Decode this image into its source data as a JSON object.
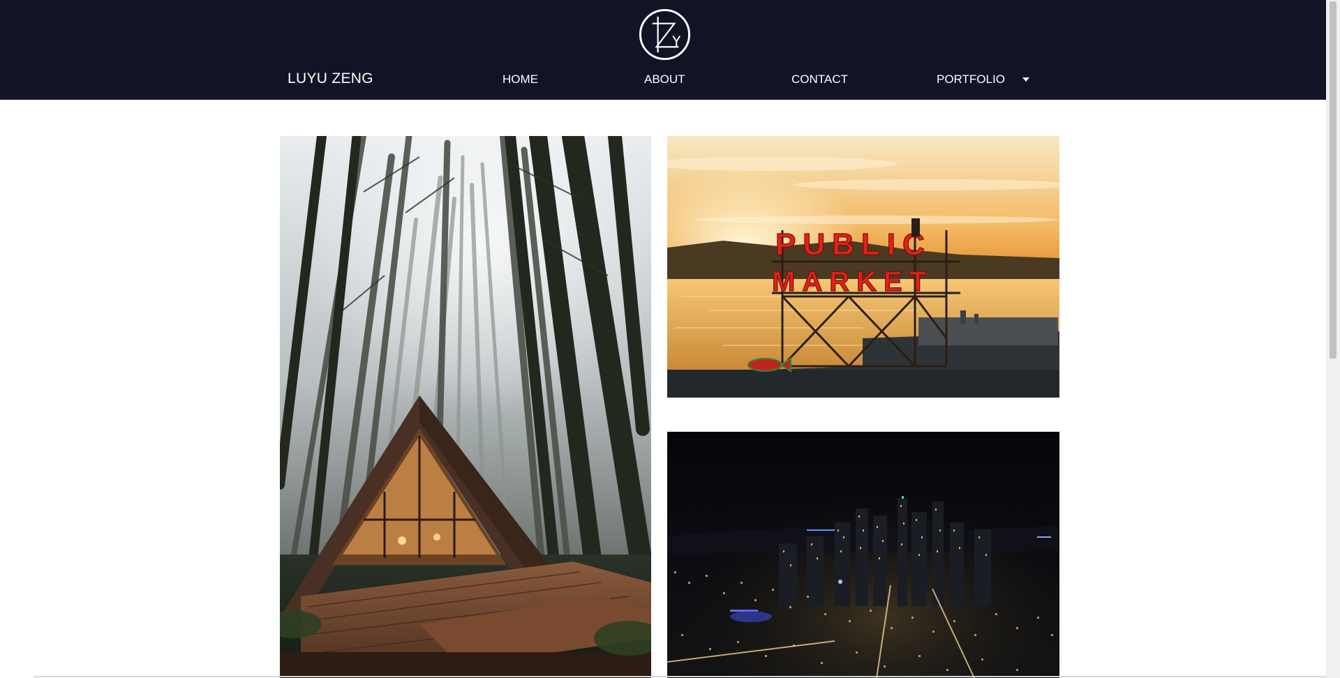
{
  "header": {
    "logo_icon": "lz-monogram-logo",
    "brand": "LUYU ZENG",
    "nav": {
      "home": "HOME",
      "about": "ABOUT",
      "contact": "CONTACT",
      "portfolio": "PORTFOLIO"
    },
    "dropdown_icon": "caret-down-icon",
    "background_color": "#121325"
  },
  "gallery": {
    "photos": [
      {
        "name": "a-frame-cabin-forest",
        "description_icon": "forest-cabin-photo"
      },
      {
        "name": "public-market-sunset",
        "sign_text": [
          "PUBLIC",
          "MARKET"
        ]
      },
      {
        "name": "city-night-skyline",
        "description_icon": "city-night-photo"
      }
    ]
  }
}
